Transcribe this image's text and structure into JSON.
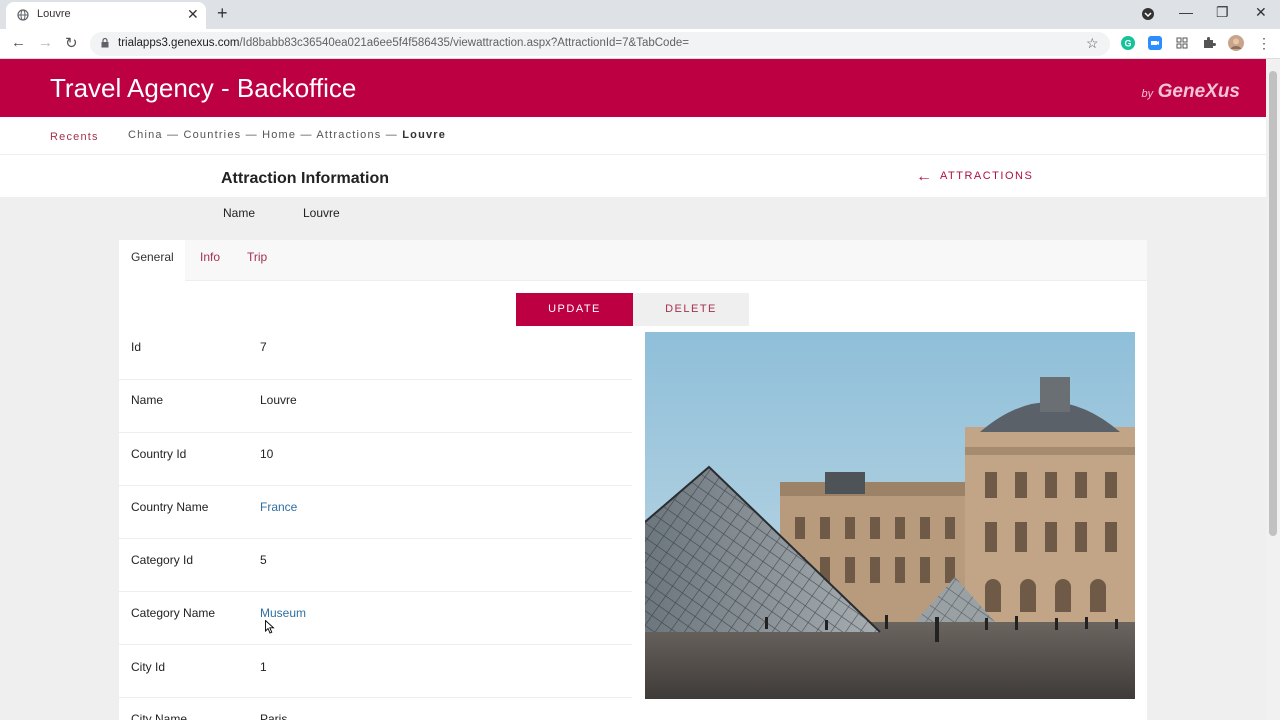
{
  "browser": {
    "tab_title": "Louvre",
    "url_host": "trialapps3.genexus.com",
    "url_path": "/Id8babb83c36540ea021a6ee5f4f586435/viewattraction.aspx?AttractionId=7&TabCode="
  },
  "header": {
    "title": "Travel Agency - Backoffice",
    "brand_by": "by",
    "brand_name": "GeneXus"
  },
  "breadcrumb": {
    "recents": "Recents",
    "items": [
      "China",
      "Countries",
      "Home",
      "Attractions",
      "Louvre"
    ],
    "separator": " — "
  },
  "page": {
    "title": "Attraction Information",
    "back_label": "ATTRACTIONS",
    "name_label": "Name",
    "name_value": "Louvre"
  },
  "tabs": [
    "General",
    "Info",
    "Trip"
  ],
  "actions": {
    "update": "UPDATE",
    "delete": "DELETE"
  },
  "attributes": [
    {
      "label": "Id",
      "value": "7",
      "link": false
    },
    {
      "label": "Name",
      "value": "Louvre",
      "link": false
    },
    {
      "label": "Country Id",
      "value": "10",
      "link": false
    },
    {
      "label": "Country Name",
      "value": "France",
      "link": true
    },
    {
      "label": "Category Id",
      "value": "5",
      "link": false
    },
    {
      "label": "Category Name",
      "value": "Museum",
      "link": true
    },
    {
      "label": "City Id",
      "value": "1",
      "link": false
    },
    {
      "label": "City Name",
      "value": "Paris",
      "link": false
    }
  ],
  "colors": {
    "brand": "#bd0041",
    "link": "#2f6fa3"
  }
}
